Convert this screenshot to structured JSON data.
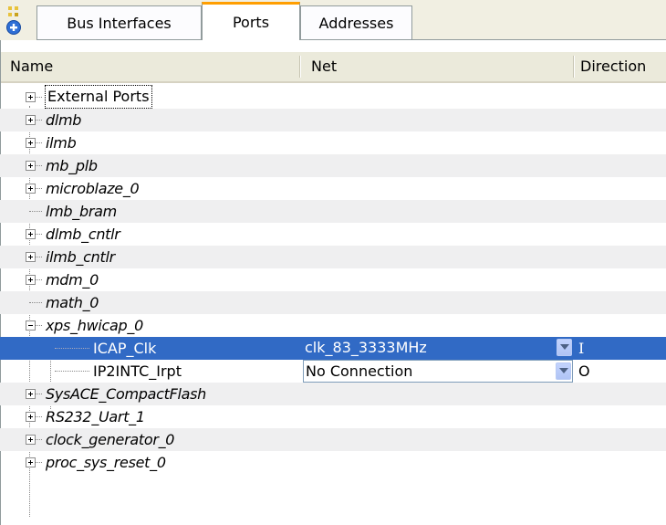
{
  "tabs": [
    {
      "label": "Bus Interfaces",
      "active": false
    },
    {
      "label": "Ports",
      "active": true
    },
    {
      "label": "Addresses",
      "active": false
    }
  ],
  "columns": {
    "name": "Name",
    "net": "Net",
    "direction": "Direction"
  },
  "tree": {
    "external_ports": "External Ports",
    "items": [
      {
        "label": "dlmb",
        "expand": "plus"
      },
      {
        "label": "ilmb",
        "expand": "plus"
      },
      {
        "label": "mb_plb",
        "expand": "plus"
      },
      {
        "label": "microblaze_0",
        "expand": "plus"
      },
      {
        "label": "lmb_bram",
        "expand": "none"
      },
      {
        "label": "dlmb_cntlr",
        "expand": "plus"
      },
      {
        "label": "ilmb_cntlr",
        "expand": "plus"
      },
      {
        "label": "mdm_0",
        "expand": "plus"
      },
      {
        "label": "math_0",
        "expand": "none"
      },
      {
        "label": "xps_hwicap_0",
        "expand": "minus"
      }
    ],
    "ports": [
      {
        "name": "ICAP_Clk",
        "net": "clk_83_3333MHz",
        "direction": "I",
        "selected": true
      },
      {
        "name": "IP2INTC_Irpt",
        "net": "No Connection",
        "direction": "O",
        "selected": false
      }
    ],
    "more_items": [
      {
        "label": "SysACE_CompactFlash",
        "expand": "plus"
      },
      {
        "label": "RS232_Uart_1",
        "expand": "plus"
      },
      {
        "label": "clock_generator_0",
        "expand": "plus"
      },
      {
        "label": "proc_sys_reset_0",
        "expand": "plus"
      }
    ]
  },
  "colors": {
    "selection": "#316ac5",
    "active_tab_accent": "#ff9e00",
    "row_shade": "#efeff0"
  }
}
